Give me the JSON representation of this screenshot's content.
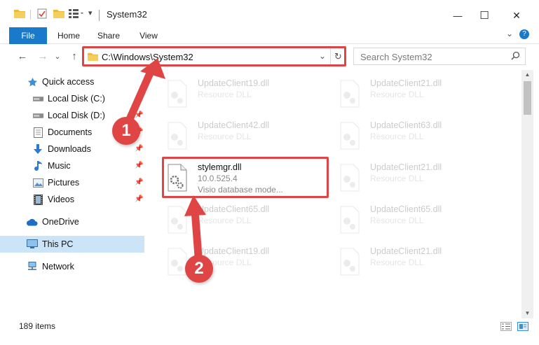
{
  "window": {
    "title": "System32",
    "minimize": "—",
    "maximize": "☐",
    "close": "✕"
  },
  "ribbon": {
    "tabs": [
      "File",
      "Home",
      "Share",
      "View"
    ],
    "expand": "⌄",
    "help": "?"
  },
  "address": {
    "path": "C:\\Windows\\System32",
    "dropdown": "⌄",
    "refresh": "↻"
  },
  "search": {
    "placeholder": "Search System32",
    "icon": "⌕"
  },
  "nav_buttons": {
    "back": "←",
    "forward": "→",
    "recent": "⌄",
    "up": "↑"
  },
  "nav_pane": [
    {
      "label": "Quick access",
      "icon": "star-icon",
      "pinned": false
    },
    {
      "label": "Local Disk (C:)",
      "icon": "drive-icon",
      "pinned": false
    },
    {
      "label": "Local Disk (D:)",
      "icon": "drive-icon",
      "pinned": true
    },
    {
      "label": "Documents",
      "icon": "documents-icon",
      "pinned": true
    },
    {
      "label": "Downloads",
      "icon": "downloads-icon",
      "pinned": true
    },
    {
      "label": "Music",
      "icon": "music-icon",
      "pinned": true
    },
    {
      "label": "Pictures",
      "icon": "pictures-icon",
      "pinned": true
    },
    {
      "label": "Videos",
      "icon": "videos-icon",
      "pinned": true
    },
    {
      "label": "OneDrive",
      "icon": "cloud-icon",
      "pinned": false
    },
    {
      "label": "This PC",
      "icon": "computer-icon",
      "pinned": false,
      "selected": true
    },
    {
      "label": "Network",
      "icon": "network-icon",
      "pinned": false
    }
  ],
  "files": [
    {
      "name": "UpdateClient19.dll",
      "line2": "Resource DLL",
      "line3": "",
      "faded": true
    },
    {
      "name": "UpdateClient21.dll",
      "line2": "Resource DLL",
      "line3": "",
      "faded": true
    },
    {
      "name": "UpdateClient42.dll",
      "line2": "Resource DLL",
      "line3": "",
      "faded": true
    },
    {
      "name": "UpdateClient63.dll",
      "line2": "Resource DLL",
      "line3": "",
      "faded": true
    },
    {
      "name": "stylemgr.dll",
      "line2": "10.0.525.4",
      "line3": "Visio database mode...",
      "faded": false
    },
    {
      "name": "UpdateClient21.dll",
      "line2": "Resource DLL",
      "line3": "",
      "faded": true
    },
    {
      "name": "UpdateClient65.dll",
      "line2": "Resource DLL",
      "line3": "",
      "faded": true
    },
    {
      "name": "UpdateClient65.dll",
      "line2": "Resource DLL",
      "line3": "",
      "faded": true
    },
    {
      "name": "UpdateClient19.dll",
      "line2": "Resource DLL",
      "line3": "",
      "faded": true
    },
    {
      "name": "UpdateClient21.dll",
      "line2": "Resource DLL",
      "line3": "",
      "faded": true
    }
  ],
  "status": {
    "item_count": "189 items"
  },
  "annotations": [
    {
      "number": "1"
    },
    {
      "number": "2"
    }
  ],
  "colors": {
    "accent": "#1979ca",
    "highlight": "#e04545",
    "selection": "#cce4f7"
  }
}
